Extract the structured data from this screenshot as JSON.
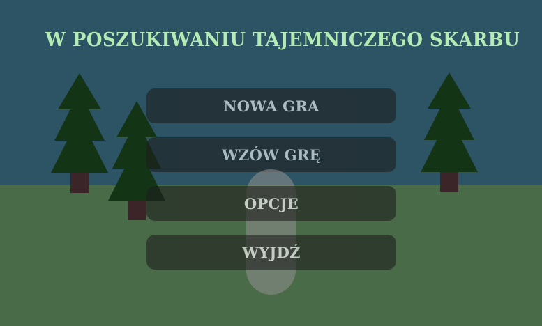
{
  "title": "W POSZUKIWANIU TAJEMNICZEGO SKARBU",
  "menu": {
    "new_game": "NOWA GRA",
    "load_game": "WZÓW GRĘ",
    "options": "OPCJE",
    "quit": "WYJDŹ"
  },
  "colors": {
    "sky": "#2c5464",
    "ground": "#4a6b47",
    "title": "#b4ebb4",
    "tree_foliage": "#133516",
    "tree_trunk": "#3c2528",
    "button_bg": "#1e1e1e"
  }
}
